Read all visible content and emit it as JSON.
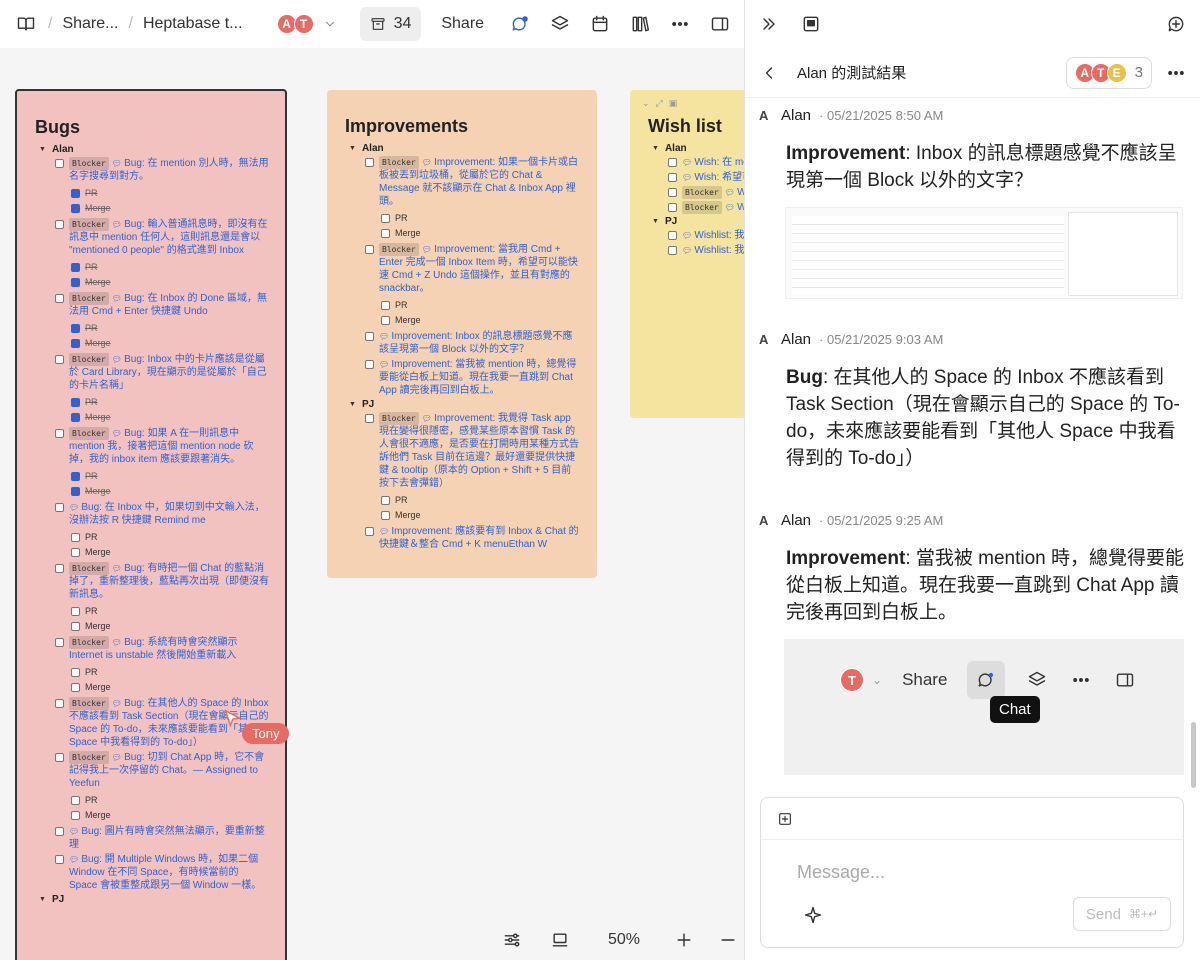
{
  "topbar": {
    "crumbs": [
      "Share...",
      "Heptabase t..."
    ],
    "members": [
      {
        "initial": "A",
        "color": "#e86b63"
      },
      {
        "initial": "T",
        "color": "#e86b63"
      }
    ],
    "card_count": "34",
    "share_label": "Share"
  },
  "board": {
    "bugs": {
      "title": "Bugs",
      "group": "Alan",
      "group2": "PJ",
      "items": [
        {
          "blocker": true,
          "text": "Bug: 在 mention 別人時，無法用名字搜尋到對方。",
          "subs": true,
          "done": true
        },
        {
          "blocker": true,
          "text": "Bug: 輸入普通訊息時，即沒有在訊息中 mention 任何人，這則訊息還是會以 \"mentioned 0 people\" 的格式進到 Inbox",
          "subs": true,
          "done": true
        },
        {
          "blocker": true,
          "text": "Bug: 在 Inbox 的 Done 區域，無法用 Cmd + Enter 快捷鍵 Undo",
          "subs": true,
          "done": true
        },
        {
          "blocker": true,
          "text": "Bug: Inbox 中的卡片應該是從屬於 Card Library，現在顯示的是從屬於「自己的卡片名稱」",
          "subs": true,
          "done": true
        },
        {
          "blocker": true,
          "text": "Bug: 如果 A 在一則訊息中 mention 我，接著把這個 mention node 砍掉，我的 inbox item 應該要跟著消失。",
          "subs": true,
          "done": true
        },
        {
          "blocker": false,
          "text": "Bug: 在 Inbox 中，如果切到中文輸入法，沒辦法按 R 快捷鍵 Remind me",
          "subs": true,
          "done": false
        },
        {
          "blocker": true,
          "text": "Bug: 有時把一個 Chat 的藍點消掉了，重新整理後，藍點再次出現（即便沒有新訊息。",
          "subs": true,
          "done": false
        },
        {
          "blocker": true,
          "text": "Bug: 系統有時會突然顯示 Internet is unstable 然後開始重新載入",
          "subs": true,
          "done": false
        },
        {
          "blocker": true,
          "text": "Bug: 在其他人的 Space 的 Inbox 不應該看到 Task Section（現在會顯示自己的 Space 的 To-do，未來應該要能看到「其他人 Space 中我看得到的 To-do」）",
          "subs": false,
          "done": false
        },
        {
          "blocker": true,
          "text": "Bug: 切到 Chat App 時，它不會記得我上一次停留的 Chat。— Assigned to Yeefun",
          "subs": true,
          "done": false
        },
        {
          "blocker": false,
          "text": "Bug: 圖片有時會突然無法顯示，要重新整理",
          "subs": false,
          "done": false
        },
        {
          "blocker": false,
          "text": "Bug: 開 Multiple Windows 時，如果二個 Window 在不同 Space，有時候當前的 Space 會被重整成跟另一個 Window 一樣。",
          "subs": false,
          "done": false
        }
      ]
    },
    "improvements": {
      "title": "Improvements",
      "group": "Alan",
      "group2": "PJ",
      "items": [
        {
          "blocker": true,
          "text": "Improvement: 如果一個卡片或白板被丟到垃圾桶，從屬於它的 Chat & Message 就不該顯示在 Chat & Inbox App 裡頭。",
          "subs": true
        },
        {
          "blocker": true,
          "text": "Improvement: 當我用 Cmd + Enter 完成一個 Inbox Item 時，希望可以能快速 Cmd + Z Undo 這個操作，並且有對應的 snackbar。",
          "subs": true
        },
        {
          "blocker": false,
          "text": "Improvement: Inbox 的訊息標題感覺不應該呈現第一個 Block 以外的文字？",
          "subs": false
        },
        {
          "blocker": false,
          "text": "Improvement: 當我被 mention 時，總覺得要能從白板上知道。現在我要一直跳到 Chat App 讀完後再回到白板上。",
          "subs": false
        }
      ],
      "pj_items": [
        {
          "blocker": true,
          "text": "Improvement: 我覺得 Task app 現在變得很隱密，感覺某些原本習慣 Task 的人會很不適應，是否要在打開時用某種方式告訴他們 Task 目前在這邊？最好還要提供快捷鍵 & tooltip（原本的 Option + Shift + 5 目前按下去會彈錯）",
          "subs": true
        },
        {
          "blocker": false,
          "text": "Improvement: 應該要有到 Inbox & Chat 的快捷鍵＆整合 Cmd + K menuEthan W",
          "subs": false
        }
      ]
    },
    "wishlist": {
      "title": "Wish list",
      "group": "Alan",
      "group2": "PJ",
      "items": [
        {
          "blocker": false,
          "text": "Wish: 在 me 方的 email"
        },
        {
          "blocker": false,
          "text": "Wish: 希望可 右鍵 Copy Link Copy Link。"
        },
        {
          "blocker": true,
          "text": "W Inbox 的 Card i"
        },
        {
          "blocker": true,
          "text": "W 完全沒注意到這 眼一點，並且我"
        }
      ],
      "pj_items": [
        {
          "blocker": false,
          "text": "Wishlist: 我 chat ，現在不行"
        },
        {
          "blocker": false,
          "text": "Wishlist: 我 的白板去！"
        }
      ]
    },
    "pr_label": "PR",
    "merge_label": "Merge",
    "blocker_label": "Blocker",
    "cursor_user": "Tony",
    "zoom": "50%"
  },
  "panel": {
    "title": "Alan 的測試結果",
    "member_initials": [
      {
        "initial": "A",
        "color": "#e86b63"
      },
      {
        "initial": "T",
        "color": "#e86b63"
      },
      {
        "initial": "E",
        "color": "#e8c04a"
      }
    ],
    "member_count": "3",
    "messages": [
      {
        "initial": "A",
        "author": "Alan",
        "time": "· 05/21/2025 8:50 AM",
        "label": "Improvement",
        "body": ": Inbox 的訊息標題感覺不應該呈現第一個 Block 以外的文字？"
      },
      {
        "initial": "A",
        "author": "Alan",
        "time": "· 05/21/2025 9:03 AM",
        "label": "Bug",
        "body": ": 在其他人的 Space 的 Inbox 不應該看到 Task Section（現在會顯示自己的 Space 的 To-do，未來應該要能看到「其他人 Space 中我看得到的 To-do」）"
      },
      {
        "initial": "A",
        "author": "Alan",
        "time": "· 05/21/2025 9:25 AM",
        "label": "Improvement",
        "body": ": 當我被 mention 時，總覺得要能從白板上知道。現在我要一直跳到 Chat App 讀完後再回到白板上。"
      }
    ],
    "screenshot": {
      "share_label": "Share",
      "avatar": "T",
      "tooltip": "Chat"
    },
    "composer": {
      "placeholder": "Message...",
      "send_label": "Send",
      "send_shortcut": "⌘+↵"
    }
  }
}
